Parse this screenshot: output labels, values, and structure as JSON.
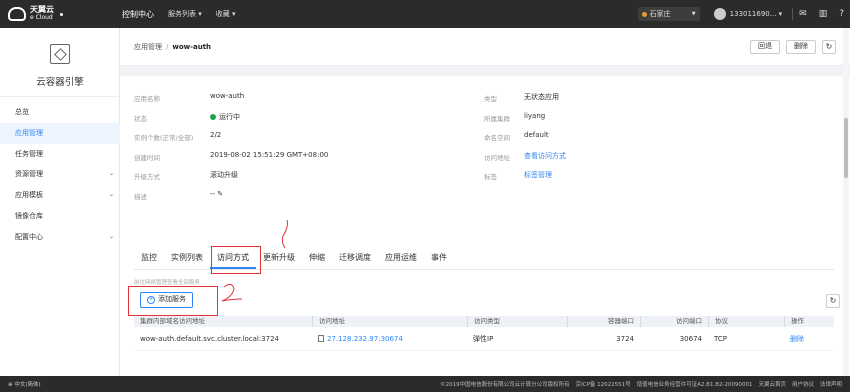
{
  "topbar": {
    "logo_line1": "天翼云",
    "logo_line2": "e Cloud",
    "nav": [
      "控制中心",
      "服务列表 ▾",
      "收藏 ▾"
    ],
    "location": "石家庄",
    "user": "133011690... ▾",
    "icons": [
      "mail-icon",
      "docs-icon",
      "help-icon"
    ]
  },
  "sidebar": {
    "title": "云容器引擎",
    "items": [
      {
        "label": "总览",
        "chevron": ""
      },
      {
        "label": "应用管理",
        "chevron": ""
      },
      {
        "label": "任务管理",
        "chevron": ""
      },
      {
        "label": "资源管理",
        "chevron": "⌄"
      },
      {
        "label": "应用模板",
        "chevron": "⌄"
      },
      {
        "label": "镜像仓库",
        "chevron": ""
      },
      {
        "label": "配置中心",
        "chevron": "⌄"
      }
    ]
  },
  "breadcrumb": {
    "parent": "应用管理",
    "sep": "/",
    "current": "wow-auth"
  },
  "actions": {
    "back": "回退",
    "delete": "删除",
    "refresh": "↻"
  },
  "info": {
    "name_label": "应用名称",
    "name": "wow-auth",
    "status_label": "状态",
    "status": "运行中",
    "instances_label": "实例个数(正常/全部)",
    "instances": "2/2",
    "created_label": "创建时间",
    "created": "2019-08-02 15:51:29 GMT+08:00",
    "upgrade_label": "升级方式",
    "upgrade": "滚动升级",
    "desc_label": "描述",
    "desc": "-- ✎",
    "type_label": "类型",
    "type": "无状态应用",
    "cluster_label": "所属集群",
    "cluster": "liyang",
    "ns_label": "命名空间",
    "ns": "default",
    "access_label": "访问地址",
    "access": "查看访问方式",
    "tag_label": "标签",
    "tag": "标签管理"
  },
  "tabs": [
    "监控",
    "实例列表",
    "访问方式",
    "更新升级",
    "伸缩",
    "迁移调度",
    "应用运维",
    "事件"
  ],
  "hint": "前往网络管理查看全部服务",
  "add_service": "添加服务",
  "table": {
    "headers": [
      "集群内部域名访问地址",
      "访问地址",
      "访问类型",
      "容器端口",
      "访问端口",
      "协议",
      "操作"
    ],
    "rows": [
      [
        "wow-auth.default.svc.cluster.local:3724",
        "27.128.232.97:30674",
        "弹性IP",
        "3724",
        "30674",
        "TCP",
        "删除"
      ]
    ]
  },
  "annotations": {
    "one": "/",
    "two": "2"
  },
  "footer": {
    "lang": "中文(简体)",
    "copyright": "©2019中国电信股份有限公司云计算分公司版权所有",
    "icp": "京ICP备 12022551号",
    "license": "增值电信业务经营许可证A2.B1.B2-20090001",
    "links": [
      "天翼云首页",
      "用户协议",
      "法律声明"
    ]
  }
}
